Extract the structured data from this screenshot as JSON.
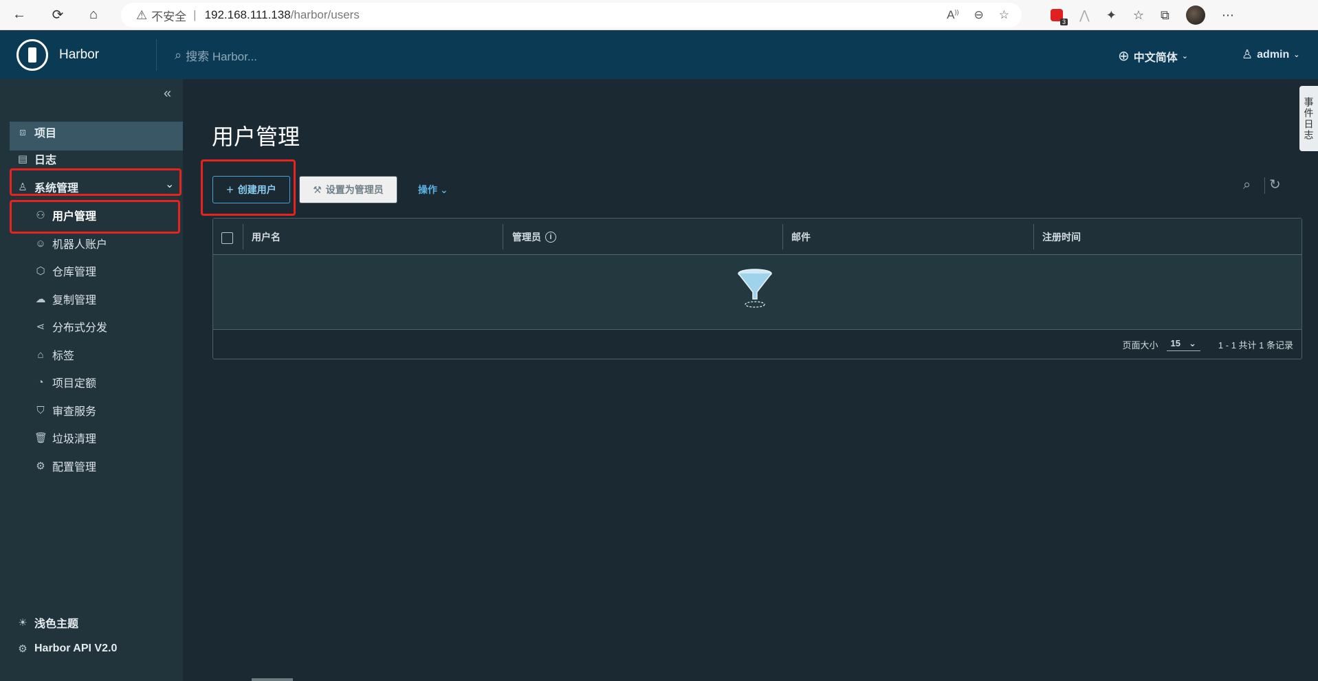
{
  "browser": {
    "insecure_label": "不安全",
    "url_host": "192.168.111.138",
    "url_path": "/harbor/users",
    "ext_badge": "3"
  },
  "header": {
    "brand": "Harbor",
    "search_placeholder": "搜索 Harbor...",
    "language": "中文简体",
    "user": "admin"
  },
  "sidebar": {
    "items": [
      {
        "label": "项目",
        "icon": "project-icon"
      },
      {
        "label": "日志",
        "icon": "log-icon"
      },
      {
        "label": "系统管理",
        "icon": "system-admin-icon"
      }
    ],
    "sub_items": [
      {
        "label": "用户管理",
        "icon": "users-icon"
      },
      {
        "label": "机器人账户",
        "icon": "robot-icon"
      },
      {
        "label": "仓库管理",
        "icon": "box-icon"
      },
      {
        "label": "复制管理",
        "icon": "cloud-icon"
      },
      {
        "label": "分布式分发",
        "icon": "share-icon"
      },
      {
        "label": "标签",
        "icon": "tag-icon"
      },
      {
        "label": "项目定额",
        "icon": "gauge-icon"
      },
      {
        "label": "审查服务",
        "icon": "shield-icon"
      },
      {
        "label": "垃圾清理",
        "icon": "trash-icon"
      },
      {
        "label": "配置管理",
        "icon": "gear-icon"
      }
    ],
    "theme_toggle": "浅色主题",
    "api_link": "Harbor API V2.0"
  },
  "main": {
    "title": "用户管理",
    "create_user": "创建用户",
    "set_admin": "设置为管理员",
    "actions": "操作",
    "columns": [
      "用户名",
      "管理员",
      "邮件",
      "注册时间"
    ],
    "page_size_label": "页面大小",
    "page_size": "15",
    "record_summary": "1 - 1 共计 1 条记录"
  },
  "side_tab": "事件日志",
  "colors": {
    "header_bg": "#0b3b54",
    "sidebar_bg": "#21333b",
    "content_bg": "#1b2a32",
    "accent": "#4aa3d6",
    "highlight_red": "#e8231d"
  }
}
